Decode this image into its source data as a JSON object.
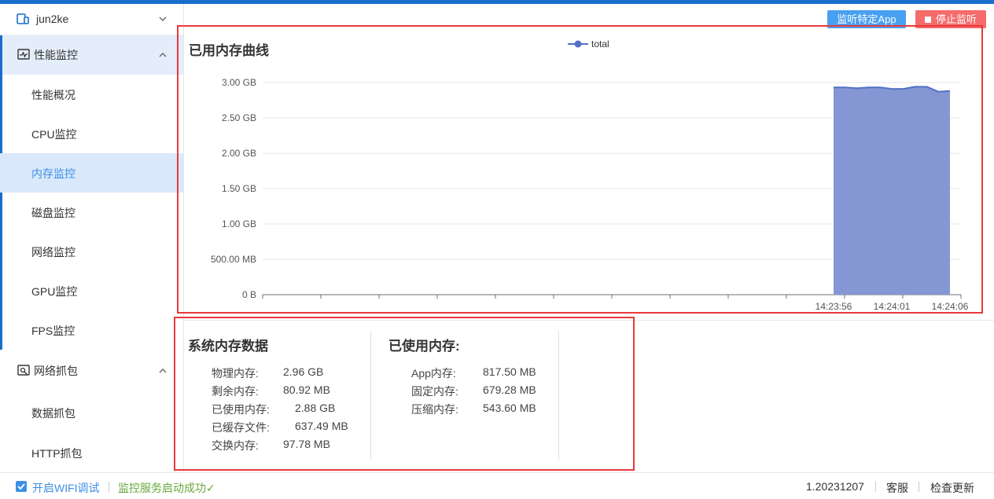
{
  "device": {
    "name": "jun2ke"
  },
  "sidebar": {
    "perf_group": "性能监控",
    "items": [
      "性能概况",
      "CPU监控",
      "内存监控",
      "磁盘监控",
      "网络监控",
      "GPU监控",
      "FPS监控"
    ],
    "active_item": "内存监控",
    "net_group": "网络抓包",
    "net_items": [
      "数据抓包",
      "HTTP抓包"
    ]
  },
  "toolbar": {
    "monitor_app": "监听特定App",
    "stop": "停止监听"
  },
  "colors": {
    "accent": "#1a6dcc",
    "series": "#5470c6",
    "area": "#8497d4",
    "stop": "#f56c6c",
    "success": "#67a83a",
    "highlight": "#e8393c"
  },
  "chart_data": {
    "type": "area",
    "title": "已用内存曲线",
    "legend": [
      "total"
    ],
    "legend_position": "top-center",
    "y_ticks": [
      "0 B",
      "500.00 MB",
      "1.00 GB",
      "1.50 GB",
      "2.00 GB",
      "2.50 GB",
      "3.00 GB"
    ],
    "ylim": [
      0,
      3.0
    ],
    "yunit": "GB",
    "x_ticks": [
      "14:23:56",
      "14:24:01",
      "14:24:06"
    ],
    "grid": true,
    "series": [
      {
        "name": "total",
        "x": [
          "14:23:56",
          "14:23:57",
          "14:23:58",
          "14:23:59",
          "14:24:00",
          "14:24:01",
          "14:24:02",
          "14:24:03",
          "14:24:04",
          "14:24:05",
          "14:24:06"
        ],
        "values": [
          2.93,
          2.93,
          2.92,
          2.93,
          2.93,
          2.91,
          2.91,
          2.94,
          2.94,
          2.87,
          2.88
        ]
      }
    ]
  },
  "system_memory": {
    "title": "系统内存数据",
    "rows": [
      {
        "k": "物理内存:",
        "v": "2.96 GB"
      },
      {
        "k": "剩余内存:",
        "v": "80.92 MB"
      },
      {
        "k": "已使用内存:",
        "v": "2.88 GB"
      },
      {
        "k": "已缓存文件:",
        "v": "637.49 MB"
      },
      {
        "k": "交换内存:",
        "v": "97.78 MB"
      }
    ]
  },
  "used_memory": {
    "title": "已使用内存:",
    "rows": [
      {
        "k": "App内存:",
        "v": "817.50 MB"
      },
      {
        "k": "固定内存:",
        "v": "679.28 MB"
      },
      {
        "k": "压缩内存:",
        "v": "543.60 MB"
      }
    ]
  },
  "footer": {
    "wifi_debug": "开启WIFI调试",
    "service_status": "监控服务启动成功✓",
    "version": "1.20231207",
    "support": "客服",
    "check_update": "检查更新"
  }
}
